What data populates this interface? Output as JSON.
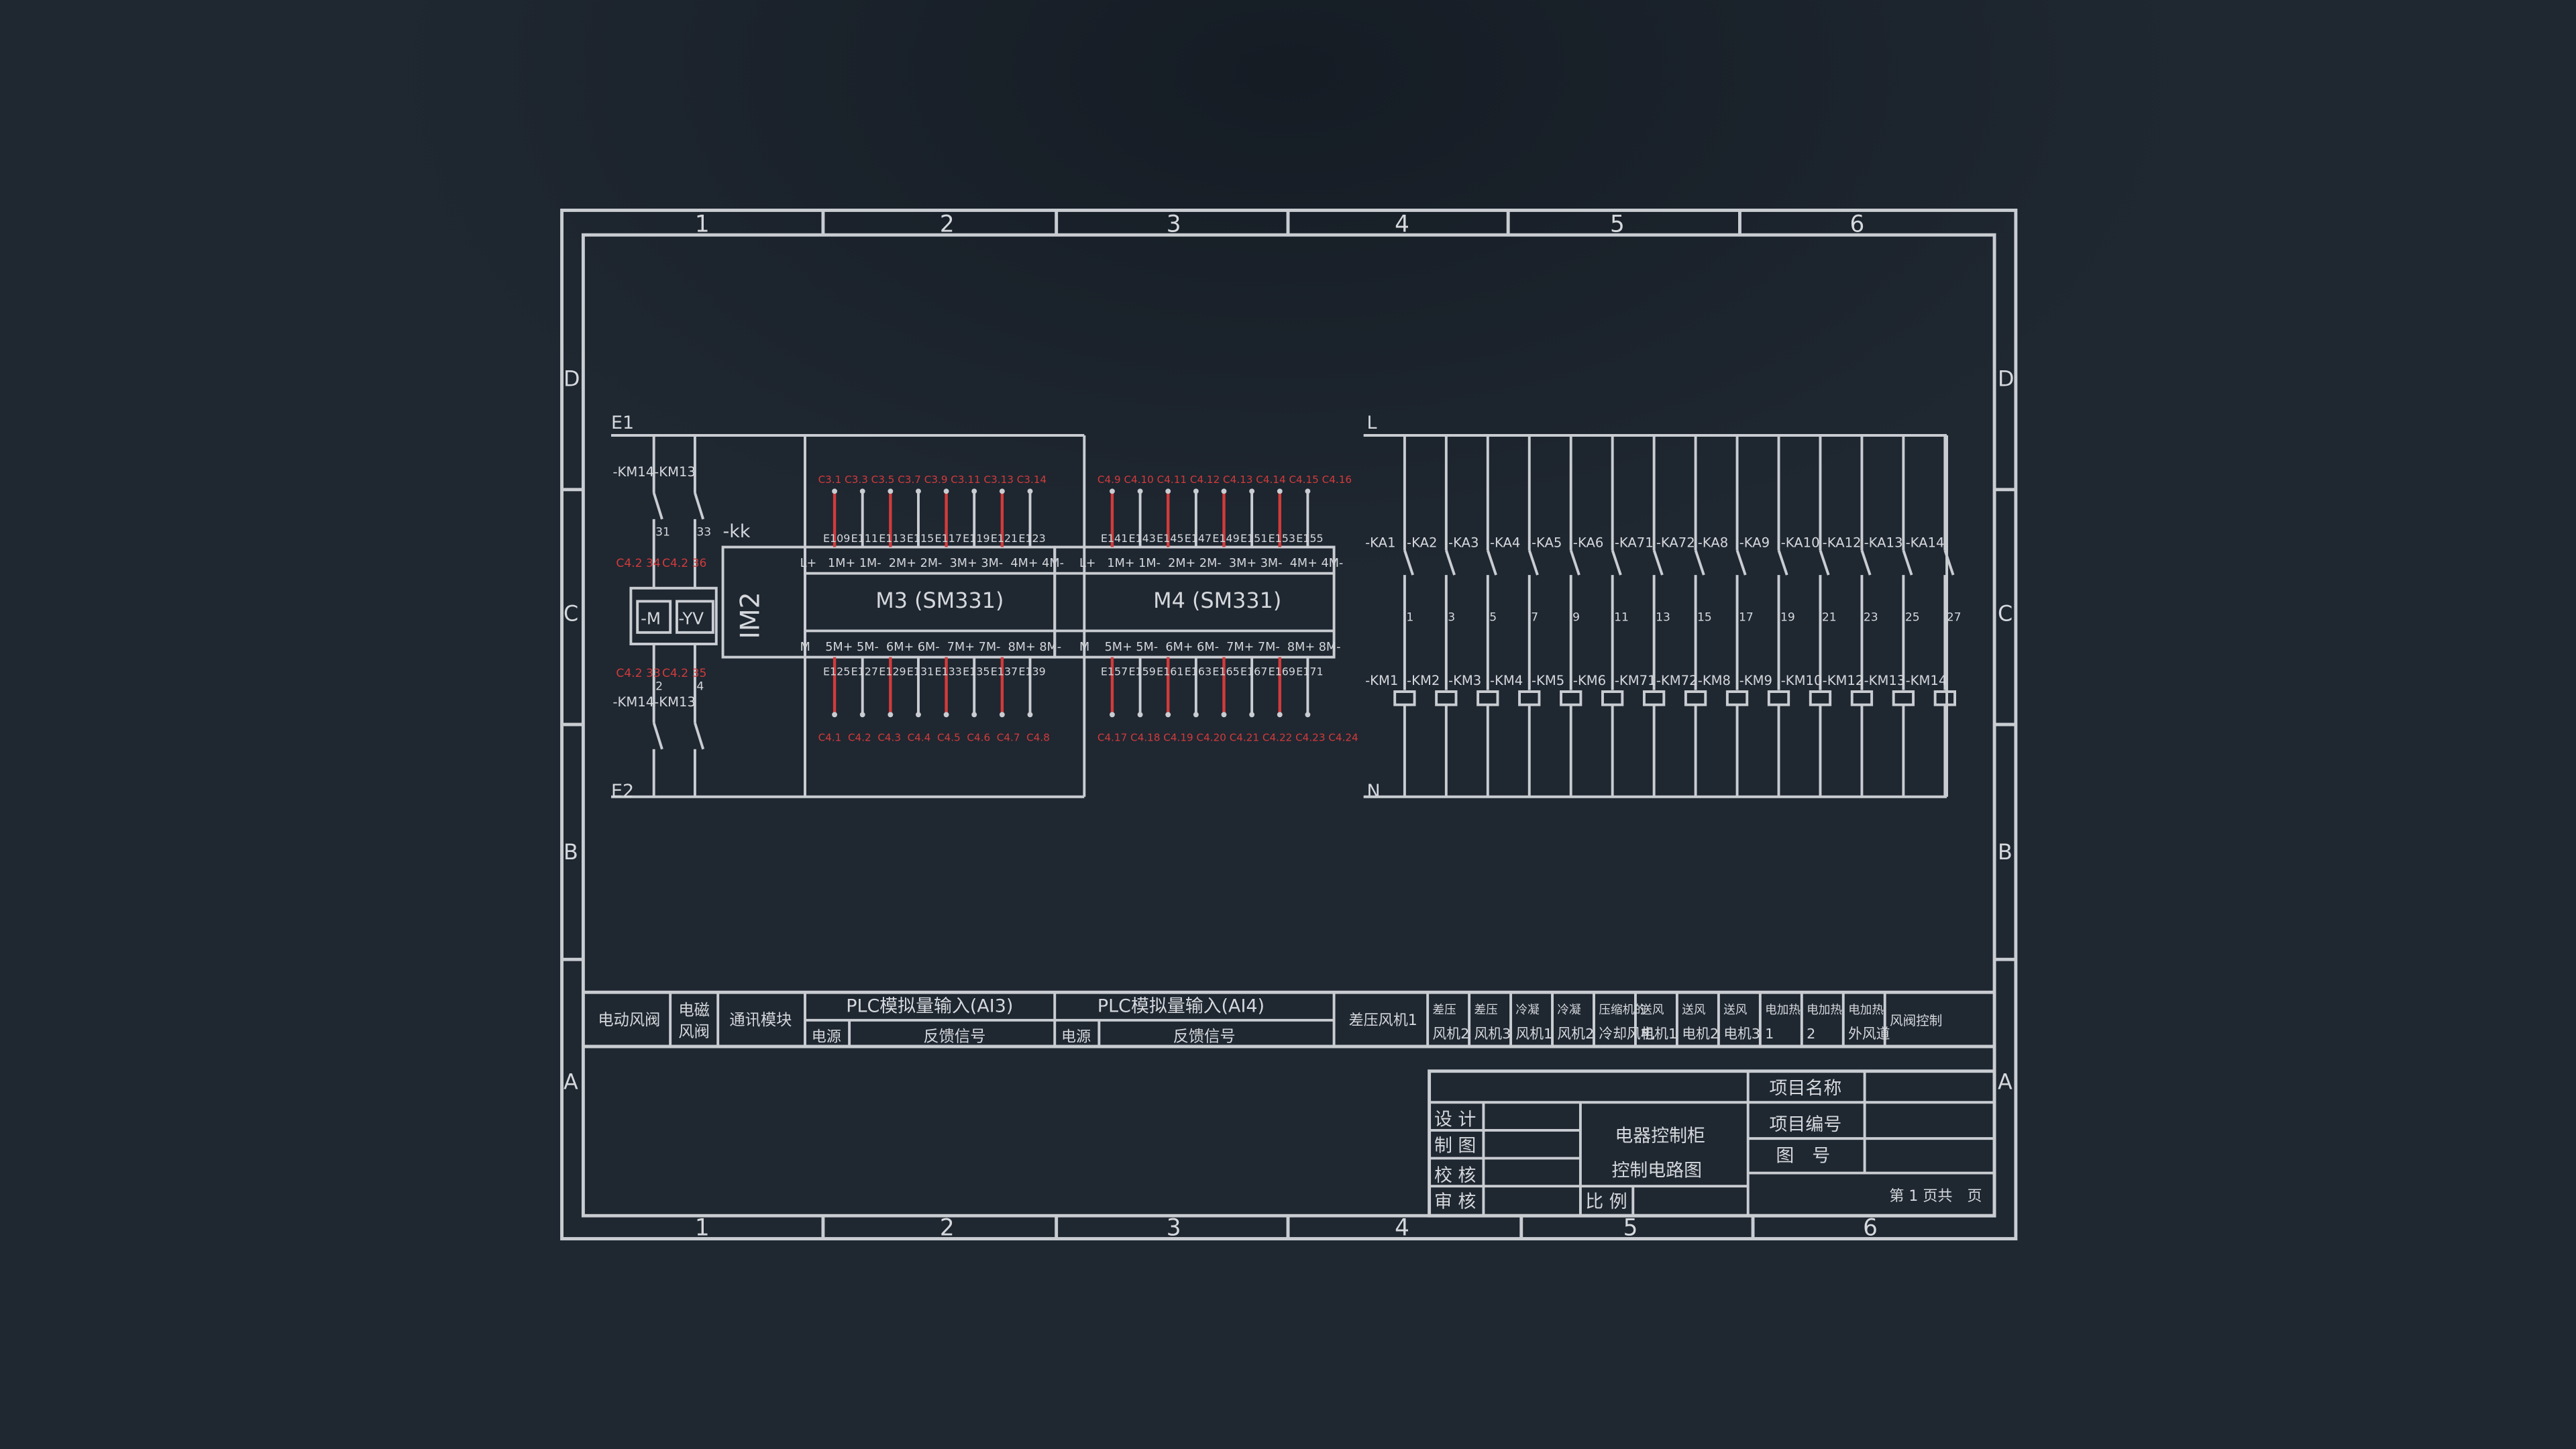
{
  "colors": {
    "background": "#1f2731",
    "line": "#c9cdd2",
    "red": "#d23b3b"
  },
  "frame": {
    "col_numbers_top": [
      "1",
      "2",
      "3",
      "4",
      "5",
      "6"
    ],
    "col_numbers_bottom": [
      "1",
      "2",
      "3",
      "4",
      "5",
      "6"
    ],
    "row_letters_left": [
      "D",
      "C",
      "B",
      "A"
    ],
    "row_letters_right": [
      "D",
      "C",
      "B",
      "A"
    ]
  },
  "left": {
    "bus_top": "E1",
    "bus_bottom": "E2",
    "km_top": "-KM14-KM13",
    "km_bottom": "-KM14-KM13",
    "nums_top": [
      "31",
      "33"
    ],
    "nums_bottom": [
      "2",
      "4"
    ],
    "red_top": [
      "C4.2 34",
      "C4.2 36"
    ],
    "red_bottom": [
      "C4.2 33",
      "C4.2 35"
    ],
    "motor": "-M",
    "valve": "-YV"
  },
  "im": {
    "kk": "-kk",
    "label": "IM2"
  },
  "m3": {
    "label": "M3 (SM331)",
    "top_pins": "L+   1M+ 1M-  2M+ 2M-  3M+ 3M-  4M+ 4M-",
    "bottom_pins": "M    5M+ 5M-  6M+ 6M-  7M+ 7M-  8M+ 8M-",
    "top_red": "C3.1 C3.3 C3.5 C3.7 C3.9 C3.11 C3.13 C3.14",
    "top_wires": [
      "E109",
      "E111",
      "E113",
      "E115",
      "E117",
      "E119",
      "E121",
      "E123"
    ],
    "bottom_wires": [
      "E125",
      "E127",
      "E129",
      "E131",
      "E133",
      "E135",
      "E137",
      "E139"
    ],
    "bottom_red": "C4.1  C4.2  C4.3  C4.4  C4.5  C4.6  C4.7  C4.8"
  },
  "m4": {
    "label": "M4 (SM331)",
    "top_pins": "L+   1M+ 1M-  2M+ 2M-  3M+ 3M-  4M+ 4M-",
    "bottom_pins": "M    5M+ 5M-  6M+ 6M-  7M+ 7M-  8M+ 8M-",
    "top_red": "C4.9 C4.10 C4.11 C4.12 C4.13 C4.14 C4.15 C4.16",
    "top_wires": [
      "E141",
      "E143",
      "E145",
      "E147",
      "E149",
      "E151",
      "E153",
      "E155"
    ],
    "bottom_wires": [
      "E157",
      "E159",
      "E161",
      "E163",
      "E165",
      "E167",
      "E169",
      "E171"
    ],
    "bottom_red": "C4.17 C4.18 C4.19 C4.20 C4.21 C4.22 C4.23 C4.24"
  },
  "relays": {
    "bus_top": "L",
    "bus_bottom": "N",
    "ka": [
      "-KA1",
      "-KA2",
      "-KA3",
      "-KA4",
      "-KA5",
      "-KA6",
      "-KA71",
      "-KA72",
      "-KA8",
      "-KA9",
      "-KA10",
      "-KA12",
      "-KA13",
      "-KA14"
    ],
    "nums": [
      "1",
      "3",
      "5",
      "7",
      "9",
      "11",
      "13",
      "15",
      "17",
      "19",
      "21",
      "23",
      "25",
      "27"
    ],
    "km": [
      "-KM1",
      "-KM2",
      "-KM3",
      "-KM4",
      "-KM5",
      "-KM6",
      "-KM71",
      "-KM72",
      "-KM8",
      "-KM9",
      "-KM10",
      "-KM12",
      "-KM13",
      "-KM14"
    ]
  },
  "bottom_labels": {
    "electric_damper": "电动风阀",
    "solenoid_valve": [
      "电磁",
      "风阀"
    ],
    "comm_module": "通讯模块",
    "ai3_title": "PLC模拟量输入(AI3)",
    "ai3_power": "电源",
    "ai3_feedback": "反馈信号",
    "ai4_title": "PLC模拟量输入(AI4)",
    "ai4_power": "电源",
    "ai4_feedback": "反馈信号",
    "diff_fan1": "差压风机1",
    "relay_cols": [
      [
        "差压",
        "风机2"
      ],
      [
        "差压",
        "风机3"
      ],
      [
        "冷凝",
        "风机1"
      ],
      [
        "冷凝",
        "风机2"
      ],
      [
        "压缩机的",
        "冷却风机"
      ],
      [
        "送风",
        "电机1"
      ],
      [
        "送风",
        "电机2"
      ],
      [
        "送风",
        "电机3"
      ],
      [
        "电加热",
        "1"
      ],
      [
        "电加热",
        "2"
      ],
      [
        "电加热",
        "外风道"
      ],
      [
        "风阀控制",
        ""
      ]
    ]
  },
  "title_block": {
    "roles": [
      "设 计",
      "制 图",
      "校 核",
      "审 核"
    ],
    "title_line1": "电器控制柜",
    "title_line2": "控制电路图",
    "scale": "比 例",
    "fields": [
      "项目名称",
      "项目编号",
      "图　号"
    ],
    "page": "第 1 页共　页"
  }
}
